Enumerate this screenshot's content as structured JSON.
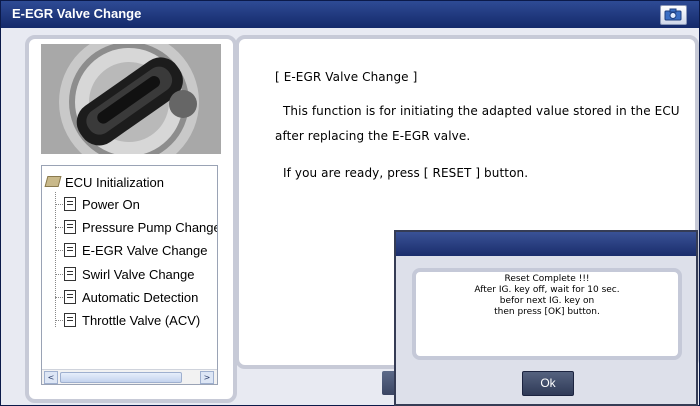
{
  "window": {
    "title": "E-EGR Valve Change"
  },
  "tree": {
    "root": "ECU Initialization",
    "items": [
      "Power On",
      "Pressure Pump Change",
      "E-EGR Valve Change",
      "Swirl Valve Change",
      "Automatic Detection",
      "Throttle Valve (ACV)"
    ],
    "scroll_left": "<",
    "scroll_right": ">"
  },
  "main": {
    "heading": "[ E-EGR Valve Change ]",
    "line1": "This function is for initiating the adapted value stored in the ECU",
    "line2": "after replacing the E-EGR valve.",
    "line3": "If you are ready, press [ RESET ] button."
  },
  "dialog": {
    "lines": [
      "Reset Complete !!!",
      "After IG. key off, wait for 10 sec.",
      "befor next IG. key on",
      "then press [OK] button."
    ],
    "ok_label": "Ok"
  },
  "icons": {
    "camera": "camera-icon",
    "folder": "folder-icon",
    "document": "document-icon"
  }
}
